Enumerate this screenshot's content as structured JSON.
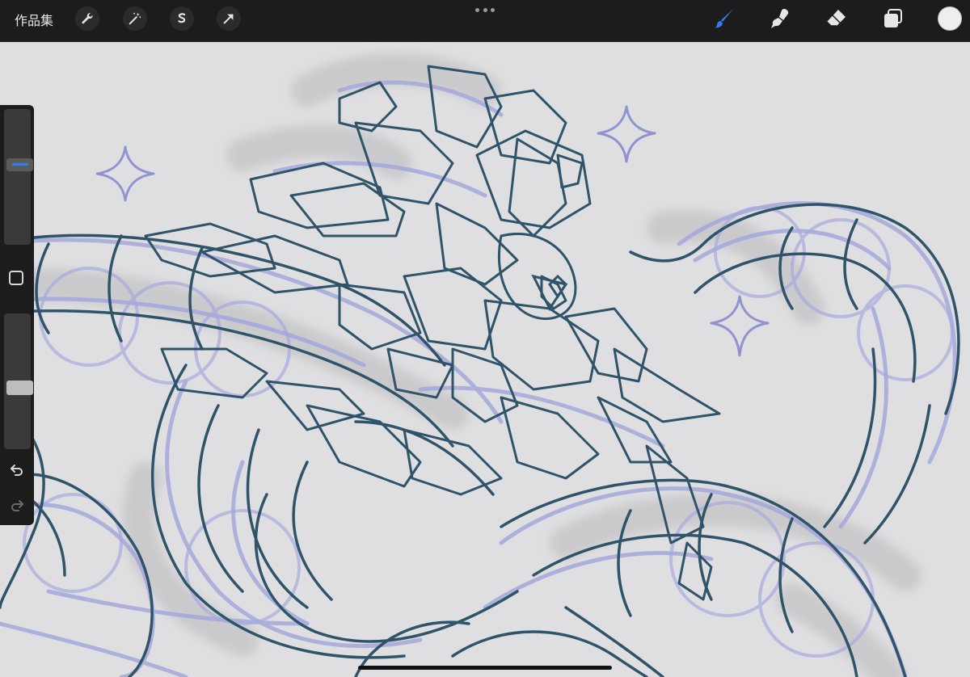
{
  "toolbar": {
    "gallery_label": "作品集"
  },
  "colors": {
    "toolbar_bg": "#1c1c1c",
    "canvas_bg": "#dfdfe1",
    "accent_brush": "#2f7cf6",
    "sketch_lines": "#2f5369",
    "sketch_underlay": "#9c9fd6",
    "current_color": "#eeeeee"
  },
  "tools": {
    "left": [
      "wrench-icon",
      "magic-wand-icon",
      "selection-icon",
      "transform-arrow-icon"
    ],
    "right": [
      "brush-icon",
      "smudge-icon",
      "eraser-icon",
      "layers-icon"
    ],
    "active": "brush-icon"
  },
  "sidebar": {
    "brush_size_level": 0.6,
    "opacity_level": 0.45
  }
}
